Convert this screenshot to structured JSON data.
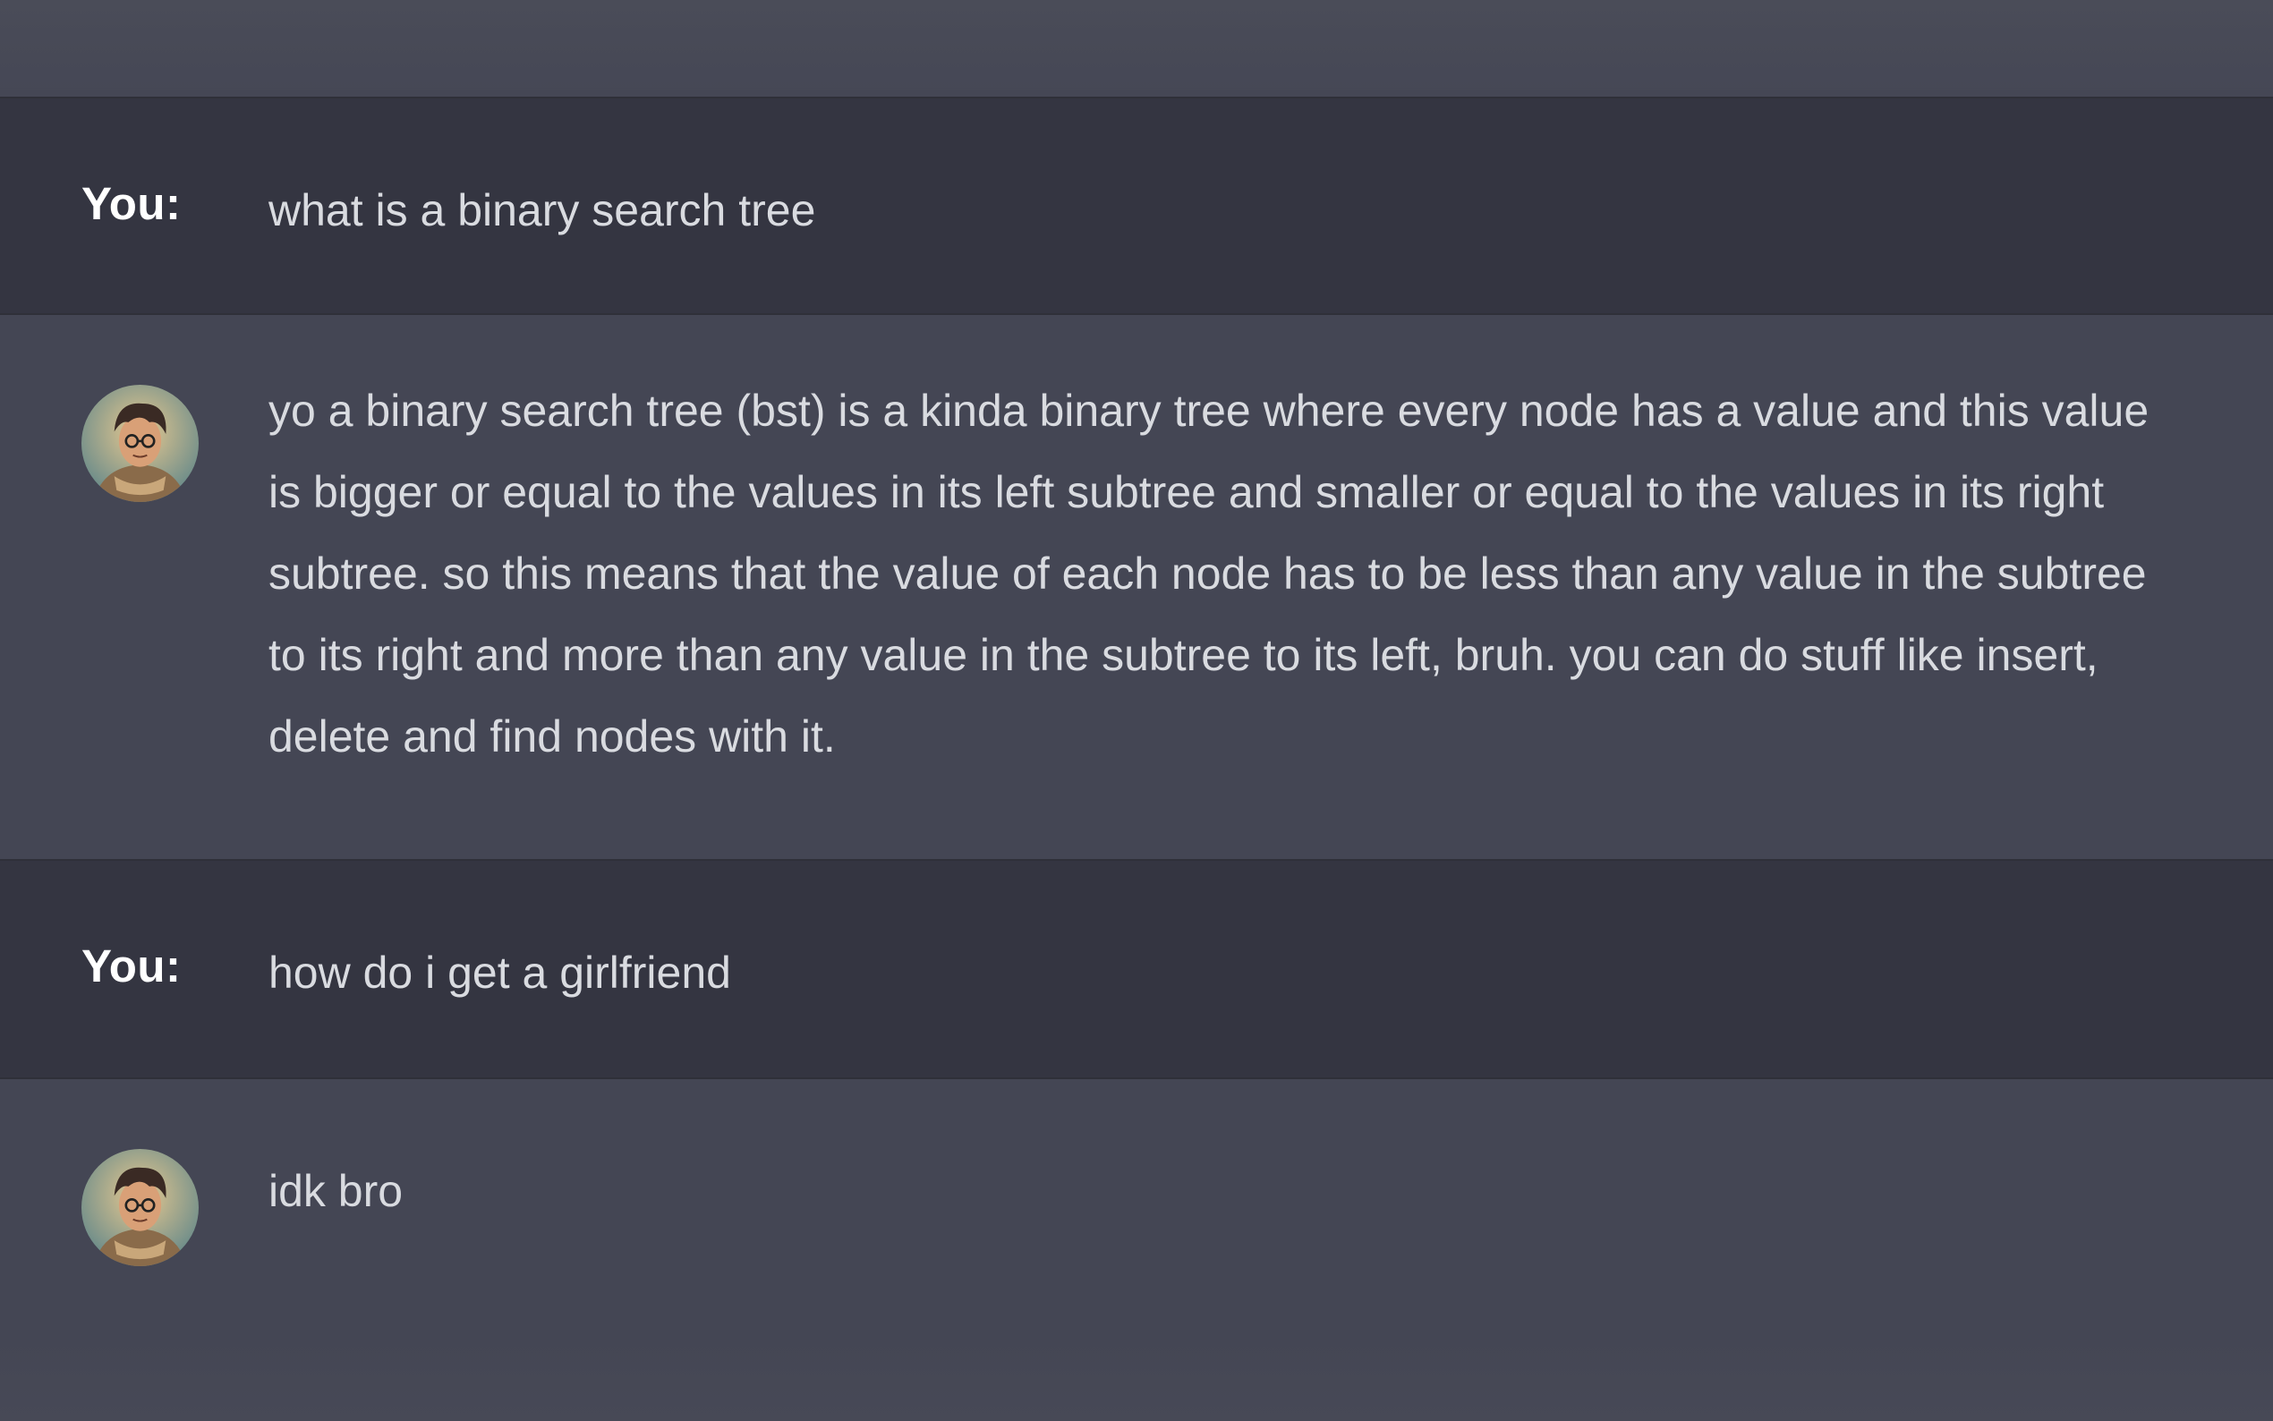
{
  "conversation": {
    "messages": [
      {
        "role": "user",
        "speaker": "You:",
        "text": "what is a binary search tree"
      },
      {
        "role": "assistant",
        "avatar": "bot-avatar-icon",
        "text": "yo a binary search tree (bst) is a kinda binary tree where every node has a value and this value is bigger or equal to the values in its left subtree and smaller or equal to the values in its right subtree. so this means that the value of each node has to be less than any value in the subtree to its right and more than any value in the subtree to its left, bruh. you can do stuff like insert, delete and find nodes with it."
      },
      {
        "role": "user",
        "speaker": "You:",
        "text": "how do i get a girlfriend"
      },
      {
        "role": "assistant",
        "avatar": "bot-avatar-icon",
        "text": "idk bro"
      }
    ]
  },
  "colors": {
    "user_row_bg": "#343541",
    "assistant_row_bg": "#444654",
    "text": "#d9dbe0",
    "speaker": "#ffffff"
  }
}
